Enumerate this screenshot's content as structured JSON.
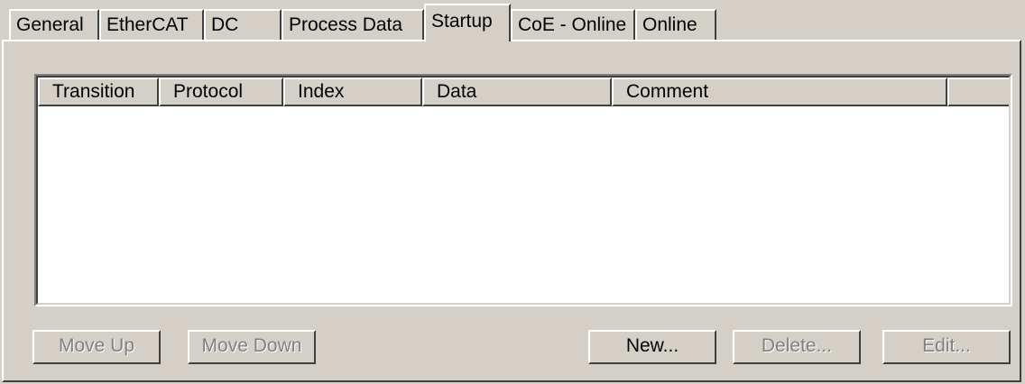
{
  "tabs": [
    {
      "label": "General"
    },
    {
      "label": "EtherCAT"
    },
    {
      "label": "DC"
    },
    {
      "label": "Process Data"
    },
    {
      "label": "Startup",
      "active": true
    },
    {
      "label": "CoE - Online"
    },
    {
      "label": "Online"
    }
  ],
  "list": {
    "columns": [
      "Transition",
      "Protocol",
      "Index",
      "Data",
      "Comment",
      ""
    ],
    "rows": []
  },
  "buttons": {
    "move_up": {
      "label": "Move Up",
      "enabled": false
    },
    "move_down": {
      "label": "Move Down",
      "enabled": false
    },
    "new": {
      "label": "New...",
      "enabled": true
    },
    "delete": {
      "label": "Delete...",
      "enabled": false
    },
    "edit": {
      "label": "Edit...",
      "enabled": false
    }
  }
}
